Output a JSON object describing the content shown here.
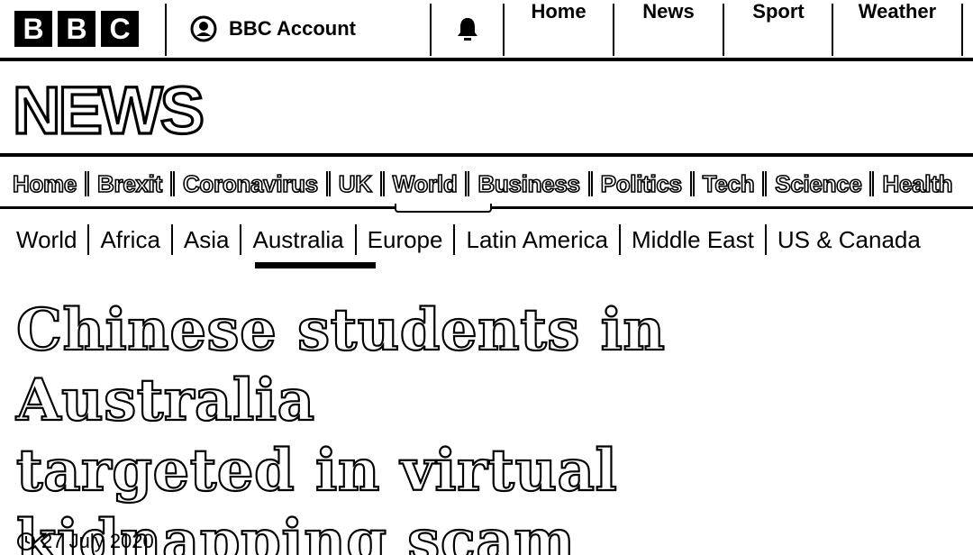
{
  "brand": {
    "logo_letters": [
      "B",
      "B",
      "C"
    ]
  },
  "account": {
    "label": "BBC Account",
    "icon": "account-icon"
  },
  "notifications": {
    "icon": "bell-icon"
  },
  "top_nav": [
    {
      "label": "Home"
    },
    {
      "label": "News"
    },
    {
      "label": "Sport"
    },
    {
      "label": "Weather"
    }
  ],
  "news_banner": {
    "wordmark": "NEWS"
  },
  "section_nav": {
    "items": [
      "Home",
      "Brexit",
      "Coronavirus",
      "UK",
      "World",
      "Business",
      "Politics",
      "Tech",
      "Science",
      "Health"
    ],
    "selected": "World"
  },
  "sub_nav": {
    "items": [
      "World",
      "Africa",
      "Asia",
      "Australia",
      "Europe",
      "Latin America",
      "Middle East",
      "US & Canada"
    ],
    "selected": "Australia"
  },
  "article": {
    "headline_lines": [
      "Chinese students in Australia",
      "targeted in virtual",
      "kidnapping scam"
    ],
    "date": "27 July 2020",
    "date_icon": "clock-icon"
  },
  "colors": {
    "foreground": "#000000",
    "background": "#ffffff"
  }
}
